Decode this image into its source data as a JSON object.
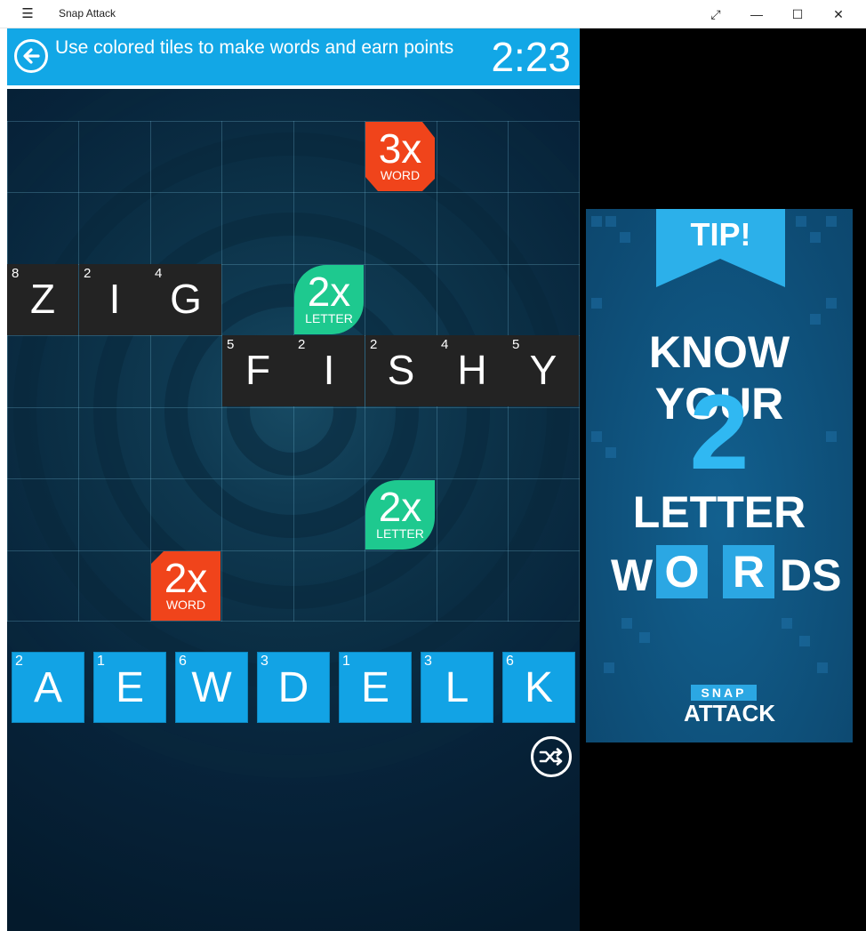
{
  "window": {
    "title": "Snap Attack",
    "menu_glyph": "☰",
    "restore_glyph": "⤢",
    "minimize_glyph": "—",
    "maximize_glyph": "☐",
    "close_glyph": "✕"
  },
  "header": {
    "instruction": "Use colored tiles to make words and earn points",
    "timer": "2:23",
    "accent_color": "#12a7e6"
  },
  "board": {
    "placed_tiles": [
      {
        "letter": "Z",
        "points": "8"
      },
      {
        "letter": "I",
        "points": "2"
      },
      {
        "letter": "G",
        "points": "4"
      },
      {
        "letter": "F",
        "points": "5"
      },
      {
        "letter": "I",
        "points": "2"
      },
      {
        "letter": "S",
        "points": "2"
      },
      {
        "letter": "H",
        "points": "4"
      },
      {
        "letter": "Y",
        "points": "5"
      }
    ],
    "bonuses": [
      {
        "multiplier": "3x",
        "kind": "WORD",
        "color": "#f0441b"
      },
      {
        "multiplier": "2x",
        "kind": "LETTER",
        "color": "#1ec98f"
      },
      {
        "multiplier": "2x",
        "kind": "LETTER",
        "color": "#1ec98f"
      },
      {
        "multiplier": "2x",
        "kind": "WORD",
        "color": "#f0441b"
      }
    ]
  },
  "rack": [
    {
      "letter": "A",
      "points": "2"
    },
    {
      "letter": "E",
      "points": "1"
    },
    {
      "letter": "W",
      "points": "6"
    },
    {
      "letter": "D",
      "points": "3"
    },
    {
      "letter": "E",
      "points": "1"
    },
    {
      "letter": "L",
      "points": "3"
    },
    {
      "letter": "K",
      "points": "6"
    }
  ],
  "controls": {
    "back_icon": "back-arrow-icon",
    "shuffle_icon": "shuffle-icon"
  },
  "ad": {
    "tip": "TIP!",
    "line1": "KNOW YOUR",
    "number": "2",
    "line3": "LETTER",
    "words_w": "W",
    "words_o": "O",
    "words_r": "R",
    "words_ds": "DS",
    "logo_top": "SNAP",
    "logo_bottom": "ATTACK"
  }
}
